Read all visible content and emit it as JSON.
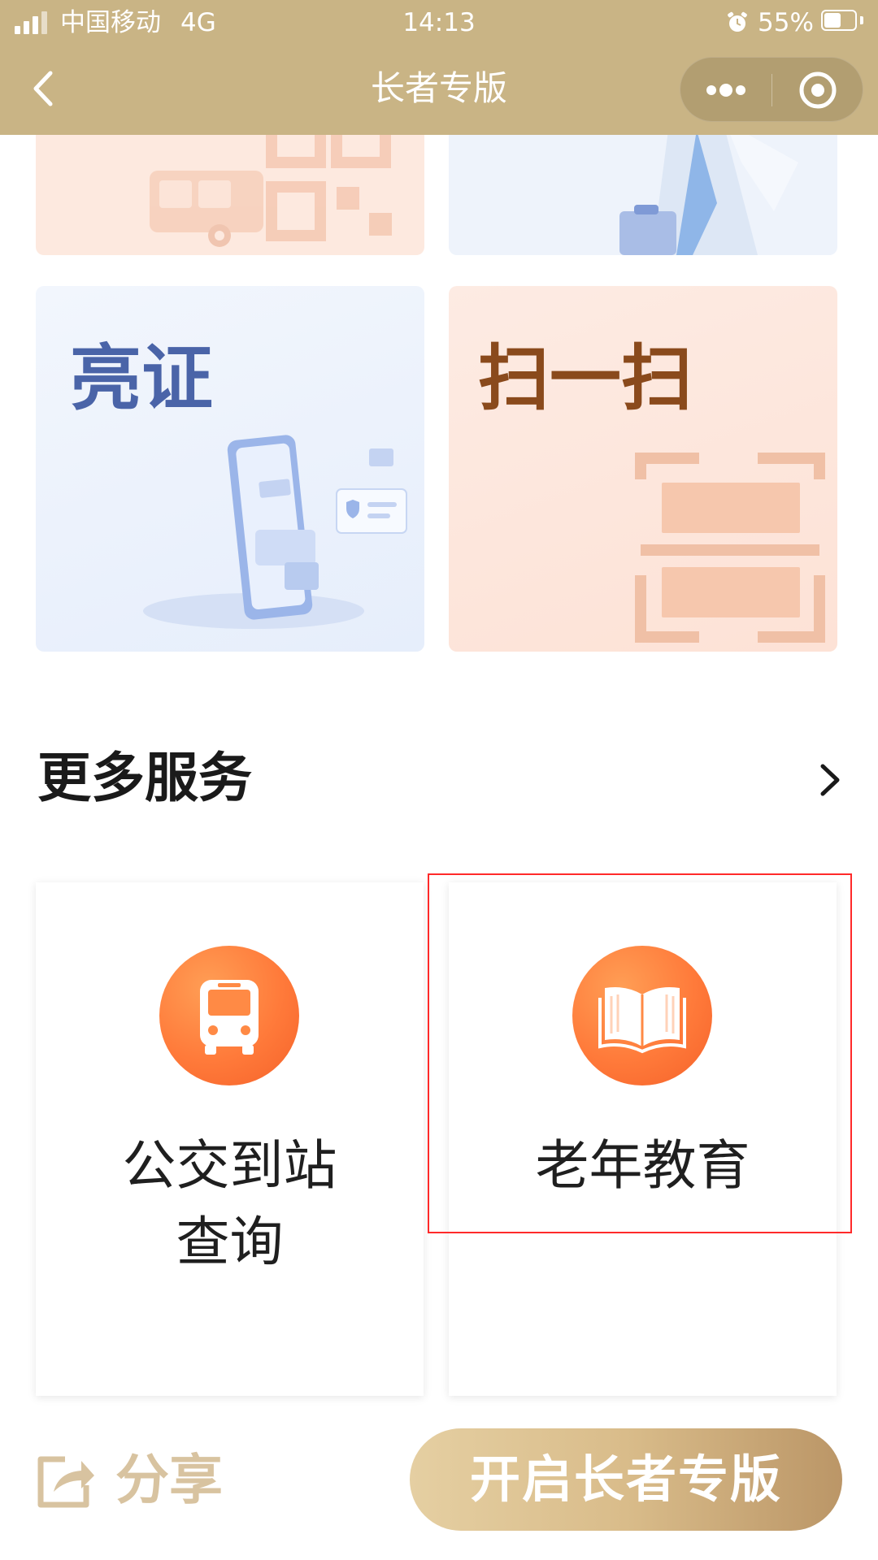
{
  "status_bar": {
    "carrier": "中国移动",
    "network": "4G",
    "time": "14:13",
    "battery_percent": "55%",
    "battery_level": 0.55
  },
  "nav": {
    "title": "长者专版",
    "back_icon": "chevron-left-icon",
    "more_icon": "more-dots-icon",
    "close_icon": "target-circle-icon"
  },
  "top_cards": [
    {
      "title": "亮证",
      "color": "#4a64a8",
      "bg": "#edf2fb"
    },
    {
      "title": "扫一扫",
      "color": "#8a4a1c",
      "bg": "#fde9df"
    }
  ],
  "more_services": {
    "title": "更多服务",
    "more_icon": "chevron-right-icon",
    "items": [
      {
        "line1": "公交到站",
        "line2": "查询",
        "icon": "bus-icon"
      },
      {
        "line1": "老年教育",
        "line2": "",
        "icon": "open-book-icon"
      }
    ]
  },
  "bottom": {
    "share_label": "分享",
    "share_icon": "share-icon",
    "enable_button": "开启长者专版"
  },
  "colors": {
    "nav_bg": "#c9b485",
    "accent_orange": "#ff7a3a",
    "highlight_border": "#ff2a2a",
    "share_text": "#d8c3a0"
  }
}
